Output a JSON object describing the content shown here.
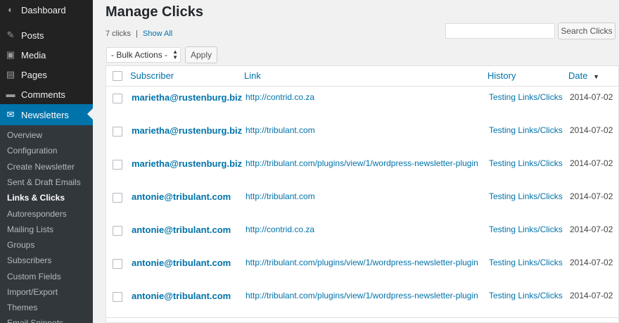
{
  "sidebar": {
    "menu": [
      {
        "label": "Dashboard",
        "icon": "dashboard-icon",
        "glyph": "◐"
      },
      {
        "label": "Posts",
        "icon": "pin-icon",
        "glyph": "✎"
      },
      {
        "label": "Media",
        "icon": "media-icon",
        "glyph": "▣"
      },
      {
        "label": "Pages",
        "icon": "pages-icon",
        "glyph": "▤"
      },
      {
        "label": "Comments",
        "icon": "comments-icon",
        "glyph": "▬"
      },
      {
        "label": "Newsletters",
        "icon": "envelope-icon",
        "glyph": "✉"
      }
    ],
    "submenu": [
      {
        "label": "Overview"
      },
      {
        "label": "Configuration"
      },
      {
        "label": "Create Newsletter"
      },
      {
        "label": "Sent & Draft Emails"
      },
      {
        "label": "Links & Clicks"
      },
      {
        "label": "Autoresponders"
      },
      {
        "label": "Mailing Lists"
      },
      {
        "label": "Groups"
      },
      {
        "label": "Subscribers"
      },
      {
        "label": "Custom Fields"
      },
      {
        "label": "Import/Export"
      },
      {
        "label": "Themes"
      },
      {
        "label": "Email Snippets"
      }
    ]
  },
  "page": {
    "title": "Manage Clicks",
    "count": "7 clicks",
    "separator": "|",
    "show_all": "Show All",
    "search_placeholder": "",
    "search_button": "Search Clicks",
    "bulk_actions": "- Bulk Actions -",
    "apply": "Apply"
  },
  "table": {
    "columns": {
      "subscriber": "Subscriber",
      "link": "Link",
      "history": "History",
      "date": "Date"
    },
    "sort_indicator": "▼",
    "rows": [
      {
        "subscriber": "marietha@rustenburg.biz",
        "link": "http://contrid.co.za",
        "history": "Testing Links/Clicks",
        "date": "2014-07-02"
      },
      {
        "subscriber": "marietha@rustenburg.biz",
        "link": "http://tribulant.com",
        "history": "Testing Links/Clicks",
        "date": "2014-07-02"
      },
      {
        "subscriber": "marietha@rustenburg.biz",
        "link": "http://tribulant.com/plugins/view/1/wordpress-newsletter-plugin",
        "history": "Testing Links/Clicks",
        "date": "2014-07-02"
      },
      {
        "subscriber": "antonie@tribulant.com",
        "link": "http://tribulant.com",
        "history": "Testing Links/Clicks",
        "date": "2014-07-02"
      },
      {
        "subscriber": "antonie@tribulant.com",
        "link": "http://contrid.co.za",
        "history": "Testing Links/Clicks",
        "date": "2014-07-02"
      },
      {
        "subscriber": "antonie@tribulant.com",
        "link": "http://tribulant.com/plugins/view/1/wordpress-newsletter-plugin",
        "history": "Testing Links/Clicks",
        "date": "2014-07-02"
      },
      {
        "subscriber": "antonie@tribulant.com",
        "link": "http://tribulant.com/plugins/view/1/wordpress-newsletter-plugin",
        "history": "Testing Links/Clicks",
        "date": "2014-07-02"
      }
    ]
  },
  "colors": {
    "accent": "#0073aa",
    "sidebar": "#222222",
    "submenu": "#32373c"
  }
}
